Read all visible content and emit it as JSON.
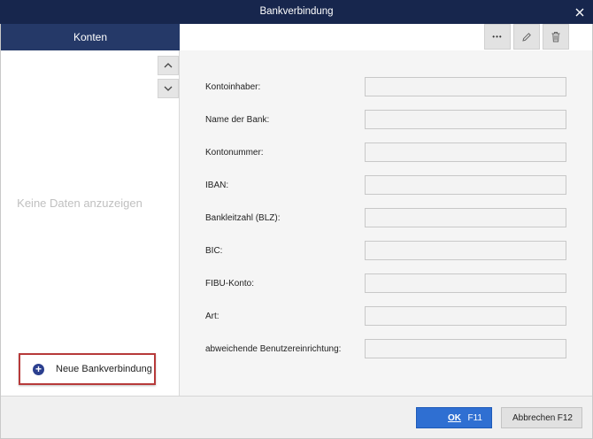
{
  "window": {
    "title": "Bankverbindung",
    "close_glyph": "✕"
  },
  "left_panel": {
    "header": "Konten",
    "empty_message": "Keine Daten anzuzeigen",
    "new_button_label": "Neue Bankverbindung",
    "new_button_icon": "plus-circle-icon"
  },
  "toolbar": {
    "more_glyph": "•••",
    "icons": [
      "more-icon",
      "pencil-icon",
      "trash-icon"
    ]
  },
  "form": {
    "fields": [
      {
        "label": "Kontoinhaber:",
        "value": ""
      },
      {
        "label": "Name der Bank:",
        "value": ""
      },
      {
        "label": "Kontonummer:",
        "value": ""
      },
      {
        "label": "IBAN:",
        "value": ""
      },
      {
        "label": "Bankleitzahl (BLZ):",
        "value": ""
      },
      {
        "label": "BIC:",
        "value": ""
      },
      {
        "label": "FIBU-Konto:",
        "value": ""
      },
      {
        "label": "Art:",
        "value": ""
      },
      {
        "label": "abweichende Benutzereinrichtung:",
        "value": ""
      }
    ]
  },
  "footer": {
    "ok_label": "OK",
    "ok_key": "F11",
    "cancel_label": "Abbrechen",
    "cancel_key": "F12"
  },
  "colors": {
    "titlebar": "#17264d",
    "panel_header": "#253968",
    "ok_button": "#2f6fd2",
    "highlight_border": "#b73a3a"
  }
}
